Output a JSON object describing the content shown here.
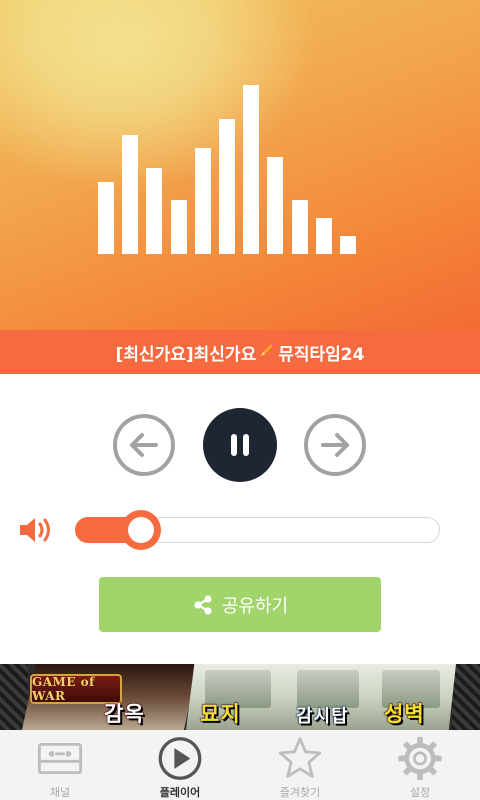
{
  "now_playing": {
    "title_prefix": "[최신가요]최신가요",
    "title_emoji": "✏",
    "title_suffix": "뮤직타임24",
    "equalizer_levels": [
      0.4,
      0.66,
      0.48,
      0.3,
      0.59,
      0.75,
      0.94,
      0.54,
      0.3,
      0.2,
      0.1
    ]
  },
  "controls": {
    "prev_icon": "arrow-left-icon",
    "play_state": "pause",
    "next_icon": "arrow-right-icon"
  },
  "volume": {
    "icon": "speaker-icon",
    "level": 0.14
  },
  "share": {
    "label": "공유하기",
    "icon": "share-icon"
  },
  "ad": {
    "logo_text": "GAME of WAR",
    "words": [
      "감옥",
      "묘지",
      "감시탑",
      "성벽"
    ]
  },
  "nav": {
    "items": [
      {
        "label": "채널",
        "icon": "cassette-icon",
        "active": false
      },
      {
        "label": "플레이어",
        "icon": "play-circle-icon",
        "active": true
      },
      {
        "label": "즐겨찾기",
        "icon": "star-icon",
        "active": false
      },
      {
        "label": "설정",
        "icon": "gear-icon",
        "active": false
      }
    ]
  },
  "colors": {
    "accent": "#f66a3f",
    "share_green": "#a1d56b",
    "pause_bg": "#1f2633",
    "control_gray": "#a2a2a2"
  }
}
